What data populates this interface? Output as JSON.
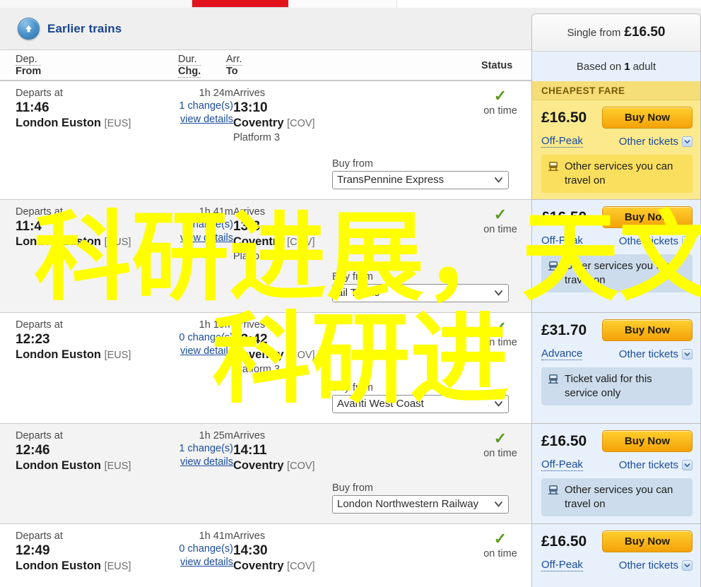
{
  "header": {
    "earlier_trains_label": "Earlier trains",
    "earlier_icon": "arrow-up-circle-icon",
    "columns": {
      "dep": "Dep.",
      "from": "From",
      "dur": "Dur.",
      "chg": "Chg.",
      "arr": "Arr.",
      "to": "To",
      "status": "Status"
    }
  },
  "summary": {
    "single_from_label": "Single from",
    "single_from_price": "£16.50",
    "based_on_prefix": "Based on",
    "based_on_count": "1",
    "based_on_suffix": "adult"
  },
  "labels": {
    "departs_at": "Departs at",
    "arrives": "Arrives",
    "buy_from": "Buy from",
    "view_details": "view details",
    "other_tickets": "Other tickets",
    "buy_now": "Buy Now",
    "cheapest_fare": "CHEAPEST FARE",
    "on_time": "on time"
  },
  "colors": {
    "brand_red": "#e3131e",
    "link_blue": "#1a4b9c",
    "cheapest_yellow": "#fbe98c",
    "fare_blue": "#e8f1fb",
    "buy_now_orange": "#f3a208",
    "tick_green": "#5a9c1e",
    "overlay_yellow": "#ffff00"
  },
  "overlay_text": {
    "line1": "科研进展，天文",
    "line2": "科研进"
  },
  "results": [
    {
      "depart_time": "11:46",
      "from_station": "London Euston",
      "from_code": "[EUS]",
      "duration": "1h 24m",
      "changes": "1 change(s)",
      "arrive_time": "13:10",
      "to_station": "Coventry",
      "to_code": "[COV]",
      "platform": "Platform 3",
      "status": "on time",
      "operator": "TransPennine Express",
      "fare": {
        "cheapest": true,
        "price": "£16.50",
        "type": "Off-Peak",
        "note": "Other services you can travel on",
        "note_icon": "train-icon"
      }
    },
    {
      "depart_time": "11:4",
      "from_station": "London Euston",
      "from_code": "[EUS]",
      "duration": "1h 41m",
      "changes": "change(s)",
      "arrive_time": "13:3",
      "to_station": "Coventry",
      "to_code": "[COV]",
      "platform": "Platform",
      "status": "on time",
      "operator": "ail Trains",
      "fare": {
        "cheapest": false,
        "price": "£16.50",
        "type": "Off-Peak",
        "note": "Other services you can travel on",
        "note_icon": "train-icon"
      }
    },
    {
      "depart_time": "12:23",
      "from_station": "London Euston",
      "from_code": "[EUS]",
      "duration": "1h 19m",
      "changes": "0 change(s)",
      "arrive_time": "13:42",
      "to_station": "Coventry",
      "to_code": "[COV]",
      "platform": "Platform 3",
      "status": "on time",
      "operator": "Avanti West Coast",
      "fare": {
        "cheapest": false,
        "price": "£31.70",
        "type": "Advance",
        "note": "Ticket valid for this service only",
        "note_icon": "train-icon"
      }
    },
    {
      "depart_time": "12:46",
      "from_station": "London Euston",
      "from_code": "[EUS]",
      "duration": "1h 25m",
      "changes": "1 change(s)",
      "arrive_time": "14:11",
      "to_station": "Coventry",
      "to_code": "[COV]",
      "platform": "",
      "status": "on time",
      "operator": "London Northwestern Railway",
      "fare": {
        "cheapest": false,
        "price": "£16.50",
        "type": "Off-Peak",
        "note": "Other services you can travel on",
        "note_icon": "train-icon"
      }
    },
    {
      "depart_time": "12:49",
      "from_station": "London Euston",
      "from_code": "[EUS]",
      "duration": "1h 41m",
      "changes": "0 change(s)",
      "arrive_time": "14:30",
      "to_station": "Coventry",
      "to_code": "[COV]",
      "platform": "",
      "status": "on time",
      "operator": "",
      "fare": {
        "cheapest": false,
        "price": "£16.50",
        "type": "Off-Peak",
        "note": "",
        "note_icon": "train-icon"
      }
    }
  ]
}
